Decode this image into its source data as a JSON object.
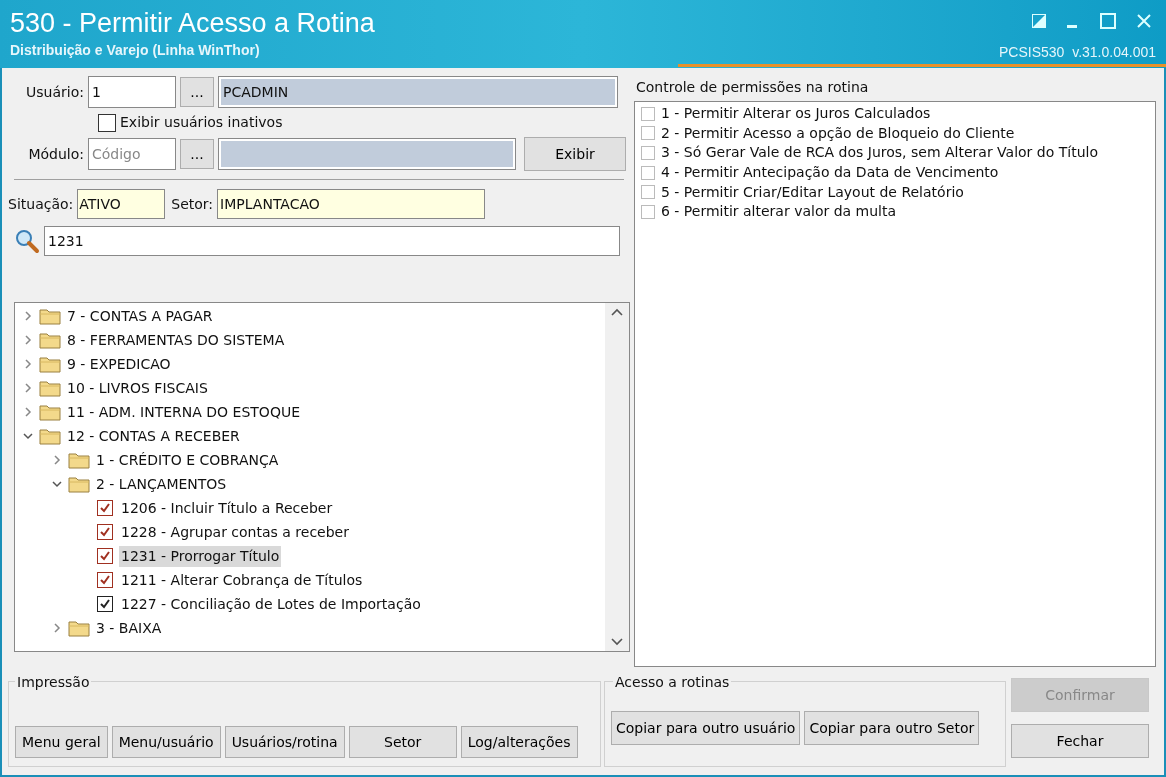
{
  "window": {
    "title": "530 - Permitir Acesso a Rotina",
    "subtitle": "Distribuição e Varejo (Linha WinThor)",
    "version": "PCSIS530  v.31.0.04.001"
  },
  "filters": {
    "usuario_label": "Usuário:",
    "usuario_code": "1",
    "usuario_name": "PCADMIN",
    "lookup_button": "...",
    "inactive_label": "Exibir usuários inativos",
    "inactive_checked": false,
    "modulo_label": "Módulo:",
    "modulo_placeholder": "Código",
    "modulo_lookup": "...",
    "show_button": "Exibir"
  },
  "status": {
    "situacao_label": "Situação:",
    "situacao": "ATIVO",
    "setor_label": "Setor:",
    "setor": "IMPLANTACAO",
    "search": "1231"
  },
  "tree": [
    {
      "kind": "folder",
      "label": "7 - CONTAS A PAGAR",
      "expanded": false
    },
    {
      "kind": "folder",
      "label": "8 - FERRAMENTAS DO SISTEMA",
      "expanded": false
    },
    {
      "kind": "folder",
      "label": "9 - EXPEDICAO",
      "expanded": false
    },
    {
      "kind": "folder",
      "label": "10 - LIVROS FISCAIS",
      "expanded": false
    },
    {
      "kind": "folder",
      "label": "11 - ADM. INTERNA DO ESTOQUE",
      "expanded": false
    },
    {
      "kind": "folder",
      "label": "12 - CONTAS A RECEBER",
      "expanded": true,
      "children": [
        {
          "kind": "folder",
          "label": "1 - CRÉDITO E COBRANÇA",
          "expanded": false
        },
        {
          "kind": "folder",
          "label": "2 - LANÇAMENTOS",
          "expanded": true,
          "children": [
            {
              "kind": "routine",
              "label": "1206 - Incluir Título a Receber",
              "checked": true,
              "color": "#a03020",
              "selected": false
            },
            {
              "kind": "routine",
              "label": "1228 - Agrupar contas a receber",
              "checked": true,
              "color": "#a03020",
              "selected": false
            },
            {
              "kind": "routine",
              "label": "1231 - Prorrogar Título",
              "checked": true,
              "color": "#a03020",
              "selected": true
            },
            {
              "kind": "routine",
              "label": "1211 - Alterar Cobrança de Títulos",
              "checked": true,
              "color": "#a03020",
              "selected": false
            },
            {
              "kind": "routine",
              "label": "1227 - Conciliação de Lotes de Importação",
              "checked": true,
              "color": "#222222",
              "selected": false
            }
          ]
        },
        {
          "kind": "folder",
          "label": "3 - BAIXA",
          "expanded": false
        }
      ]
    }
  ],
  "permissions": {
    "title": "Controle de permissões na rotina",
    "items": [
      {
        "label": "1 - Permitir Alterar os Juros Calculados",
        "checked": false
      },
      {
        "label": "2 - Permitir Acesso a opção de Bloqueio do Cliente",
        "checked": false
      },
      {
        "label": "3 - Só Gerar Vale de RCA dos Juros, sem Alterar Valor do Título",
        "checked": false
      },
      {
        "label": "4 - Permitir Antecipação da Data de Vencimento",
        "checked": false
      },
      {
        "label": "5 - Permitir Criar/Editar Layout de Relatório",
        "checked": false
      },
      {
        "label": "6 - Permitir alterar valor da multa",
        "checked": false
      }
    ]
  },
  "impressao": {
    "title": "Impressão",
    "buttons": [
      "Menu geral",
      "Menu/usuário",
      "Usuários/rotina",
      "Setor",
      "Log/alterações"
    ]
  },
  "acesso": {
    "title": "Acesso a rotinas",
    "buttons": [
      "Copiar para outro usuário",
      "Copiar para outro Setor"
    ]
  },
  "actions": [
    {
      "label": "Confirmar",
      "disabled": true
    },
    {
      "label": "Fechar",
      "disabled": false
    }
  ]
}
